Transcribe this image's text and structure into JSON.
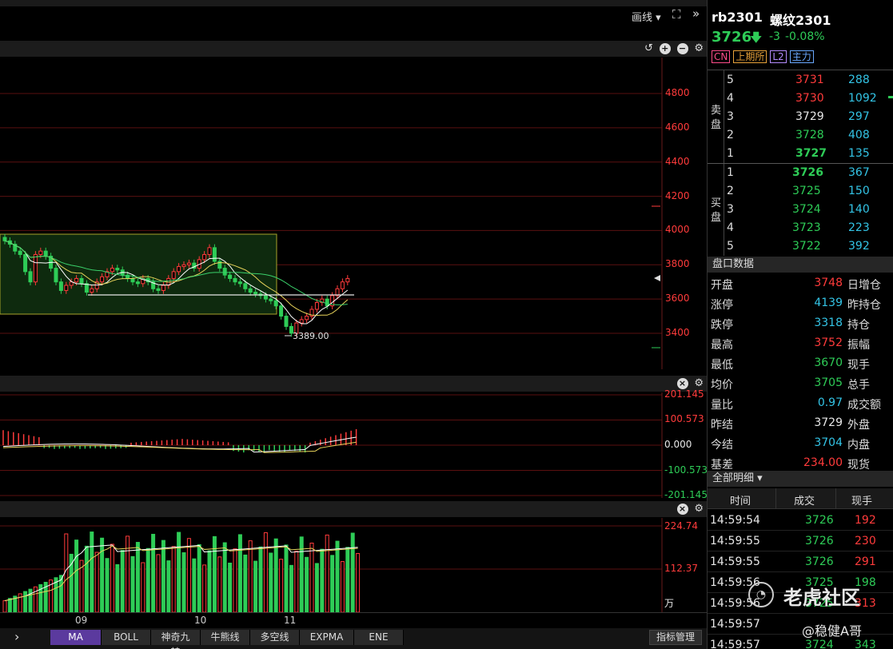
{
  "toolbar": {
    "draw_label": "画线 ▾",
    "fullscreen_icon": "expand-icon",
    "collapse_icon": "double-chevron-right-icon"
  },
  "main_chart": {
    "price_ticks": [
      "4800",
      "4600",
      "4400",
      "4200",
      "4000",
      "3800",
      "3600",
      "3400"
    ],
    "low_label": "3389.00",
    "colors": {
      "up": "#ff3b3b",
      "down": "#2ecc57",
      "grid": "#5a1010",
      "box": "#a8a22a"
    }
  },
  "macd_panel": {
    "ticks": [
      "201.145",
      "100.573",
      "0.000",
      "-100.573",
      "-201.145"
    ]
  },
  "volume_panel": {
    "ticks": [
      "224.74",
      "112.37",
      "万"
    ]
  },
  "x_axis": {
    "labels": [
      "09",
      "10",
      "11"
    ]
  },
  "bottom_bar": {
    "arrow": "›",
    "tabs": [
      "MA",
      "BOLL",
      "神奇九转",
      "牛熊线",
      "多空线",
      "EXPMA",
      "ENE"
    ],
    "indicator_manage": "指标管理"
  },
  "quote": {
    "code": "rb2301",
    "name": "螺纹2301",
    "price": "3726",
    "change": "-3",
    "change_pct": "-0.08%",
    "badges": [
      "CN",
      "上期所",
      "L2",
      "主力"
    ]
  },
  "order_book": {
    "sell_label_1": "卖",
    "sell_label_2": "盘",
    "buy_label_1": "买",
    "buy_label_2": "盘",
    "asks": [
      {
        "level": "5",
        "price": "3731",
        "vol": "288"
      },
      {
        "level": "4",
        "price": "3730",
        "vol": "1092"
      },
      {
        "level": "3",
        "price": "3729",
        "vol": "297"
      },
      {
        "level": "2",
        "price": "3728",
        "vol": "408"
      },
      {
        "level": "1",
        "price": "3727",
        "vol": "135"
      }
    ],
    "bids": [
      {
        "level": "1",
        "price": "3726",
        "vol": "367"
      },
      {
        "level": "2",
        "price": "3725",
        "vol": "150"
      },
      {
        "level": "3",
        "price": "3724",
        "vol": "140"
      },
      {
        "level": "4",
        "price": "3723",
        "vol": "223"
      },
      {
        "level": "5",
        "price": "3722",
        "vol": "392"
      }
    ]
  },
  "market_data": {
    "title": "盘口数据",
    "rows": [
      {
        "label": "开盘",
        "value": "3748",
        "color": "red",
        "right": "日增仓"
      },
      {
        "label": "涨停",
        "value": "4139",
        "color": "cyan",
        "right": "昨持仓"
      },
      {
        "label": "跌停",
        "value": "3318",
        "color": "cyan",
        "right": "持仓"
      },
      {
        "label": "最高",
        "value": "3752",
        "color": "red",
        "right": "振幅"
      },
      {
        "label": "最低",
        "value": "3670",
        "color": "green",
        "right": "现手"
      },
      {
        "label": "均价",
        "value": "3705",
        "color": "green",
        "right": "总手"
      },
      {
        "label": "量比",
        "value": "0.97",
        "color": "cyan",
        "right": "成交额"
      },
      {
        "label": "昨结",
        "value": "3729",
        "color": "white",
        "right": "外盘"
      },
      {
        "label": "今结",
        "value": "3704",
        "color": "cyan",
        "right": "内盘"
      },
      {
        "label": "基差",
        "value": "234.00",
        "color": "red",
        "right": "现货"
      }
    ]
  },
  "trades": {
    "title": "全部明细 ▾",
    "headers": [
      "时间",
      "成交",
      "现手"
    ],
    "rows": [
      {
        "time": "14:59:54",
        "price": "3726",
        "vol": "192",
        "color": "red"
      },
      {
        "time": "14:59:55",
        "price": "3726",
        "vol": "230",
        "color": "red"
      },
      {
        "time": "14:59:55",
        "price": "3726",
        "vol": "291",
        "color": "red"
      },
      {
        "time": "14:59:56",
        "price": "3725",
        "vol": "198",
        "color": "green"
      },
      {
        "time": "14:59:56",
        "price": "3725",
        "vol": "313",
        "color": "red"
      },
      {
        "time": "14:59:57",
        "price": "",
        "vol": "",
        "color": "red"
      },
      {
        "time": "14:59:57",
        "price": "3724",
        "vol": "343",
        "color": "green"
      }
    ]
  },
  "watermark": {
    "brand": "老虎社区",
    "handle": "@稳健A哥"
  }
}
